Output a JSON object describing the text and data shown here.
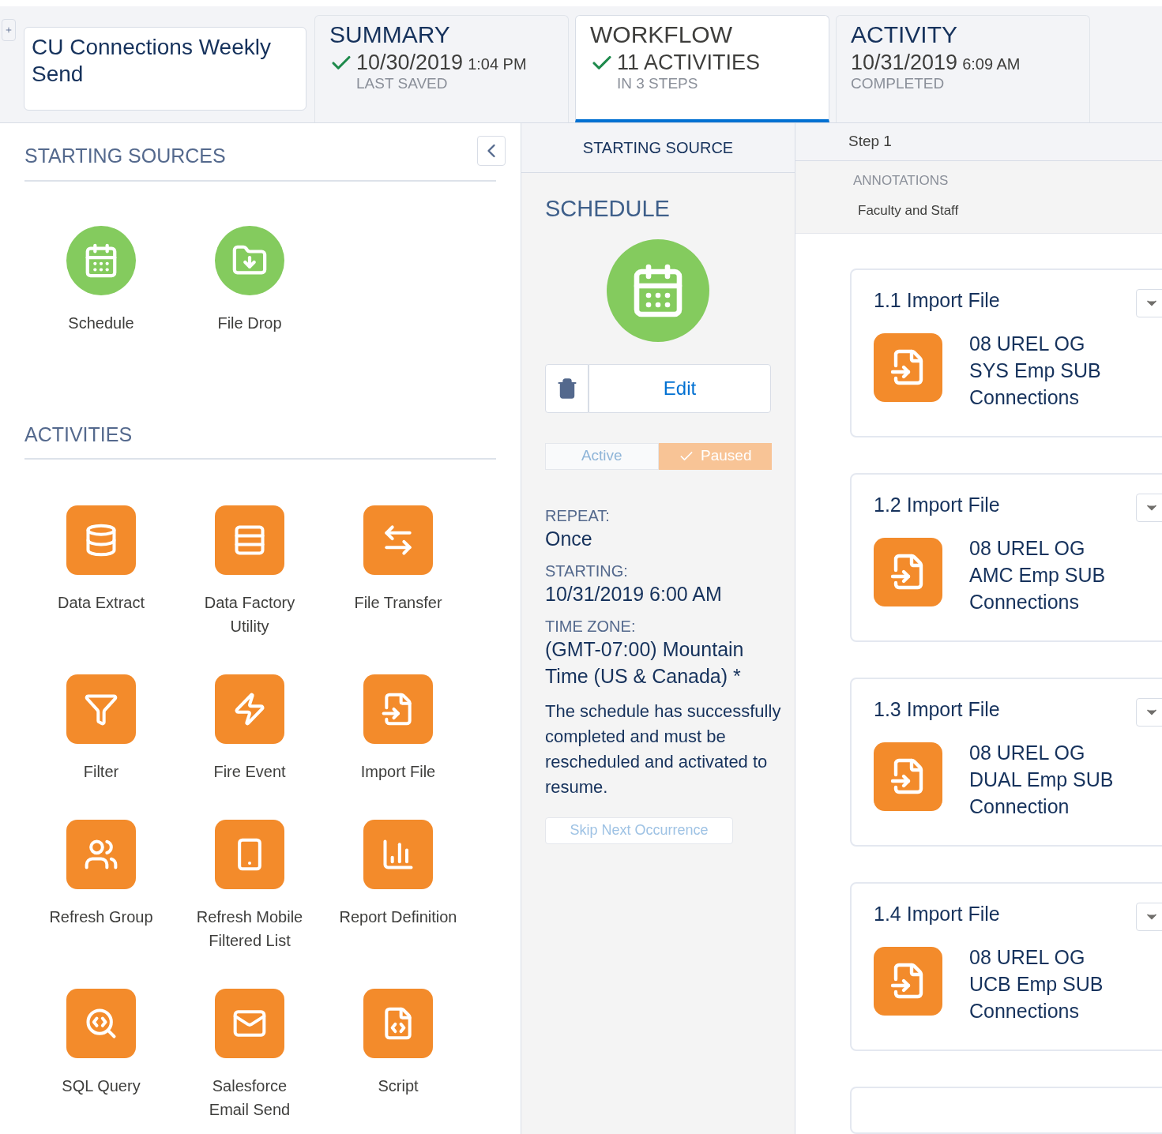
{
  "title_field": {
    "value": "CU Connections Weekly Send"
  },
  "tabs": [
    {
      "label": "SUMMARY",
      "check": true,
      "main": "10/30/2019",
      "time": "1:04 PM",
      "sub": "LAST SAVED",
      "selected": false
    },
    {
      "label": "WORKFLOW",
      "check": true,
      "main": "11 ACTIVITIES",
      "sub": "IN 3 STEPS",
      "selected": true
    },
    {
      "label": "ACTIVITY",
      "check": false,
      "main": "10/31/2019",
      "time": "6:09 AM",
      "sub": "COMPLETED",
      "selected": false
    }
  ],
  "starting_sources": {
    "heading": "STARTING SOURCES",
    "items": [
      {
        "label": "Schedule"
      },
      {
        "label": "File Drop"
      }
    ]
  },
  "activities": {
    "heading": "ACTIVITIES",
    "items": [
      {
        "label": "Data Extract"
      },
      {
        "label": "Data Factory Utility"
      },
      {
        "label": "File Transfer"
      },
      {
        "label": "Filter"
      },
      {
        "label": "Fire Event"
      },
      {
        "label": "Import File"
      },
      {
        "label": "Refresh Group"
      },
      {
        "label": "Refresh Mobile Filtered List"
      },
      {
        "label": "Report Definition"
      },
      {
        "label": "SQL Query"
      },
      {
        "label": "Salesforce Email Send"
      },
      {
        "label": "Script"
      }
    ]
  },
  "starting_source": {
    "header": "STARTING SOURCE",
    "title": "SCHEDULE",
    "edit_button": "Edit",
    "toggle": [
      {
        "label": "Active",
        "selected": false
      },
      {
        "label": "Paused",
        "selected": true
      }
    ],
    "fields": [
      {
        "label": "REPEAT:",
        "value": "Once"
      },
      {
        "label": "STARTING:",
        "value": "10/31/2019 6:00 AM"
      },
      {
        "label": "TIME ZONE:",
        "value": "(GMT-07:00) Mountain Time (US & Canada) *"
      }
    ],
    "message": "The schedule has successfully completed and must be rescheduled and activated to resume.",
    "skip_button": "Skip Next Occurrence"
  },
  "step": {
    "header": "Step 1",
    "annotations_label": "ANNOTATIONS",
    "annotations": "Faculty and Staff",
    "cards": [
      {
        "title": "1.1 Import File",
        "name": "08 UREL OG SYS Emp SUB Connections"
      },
      {
        "title": "1.2 Import File",
        "name": "08 UREL OG AMC Emp SUB Connections"
      },
      {
        "title": "1.3 Import File",
        "name": "08 UREL OG DUAL Emp SUB Connection"
      },
      {
        "title": "1.4 Import File",
        "name": "08 UREL OG UCB Emp SUB Connections"
      }
    ]
  }
}
